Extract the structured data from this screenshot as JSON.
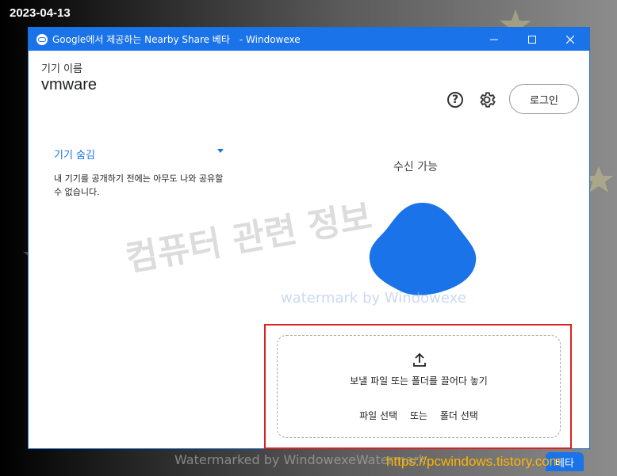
{
  "overlay": {
    "date": "2023-04-13",
    "site": "https://pcwindows.tistory.com"
  },
  "window": {
    "title": "Google에서 제공하는 Nearby Share 베타",
    "title_suffix": "- Windowexe",
    "controls": {
      "minimize": "—",
      "maximize": "☐",
      "close": "✕"
    }
  },
  "device": {
    "label": "기기 이름",
    "name": "vmware"
  },
  "header": {
    "help_icon": "?",
    "login_label": "로그인"
  },
  "visibility": {
    "selected": "기기 숨김",
    "description": "내 기기를 공개하기 전에는 아무도 나와 공유할 수 없습니다."
  },
  "receive": {
    "status": "수신 가능"
  },
  "drop": {
    "text": "보낼 파일 또는 폴더를 끌어다 놓기",
    "choose_file": "파일 선택",
    "or": "또는",
    "choose_folder": "폴더 선택"
  },
  "watermarks": {
    "big": "컴퓨터 관련 정보",
    "small": "watermark by Windowexe",
    "bottom": "Watermarked by WindowexeWatermark"
  },
  "badge": "베타",
  "colors": {
    "accent": "#1a73e8",
    "highlight_border": "#e02020",
    "site_text": "#ffb400"
  }
}
